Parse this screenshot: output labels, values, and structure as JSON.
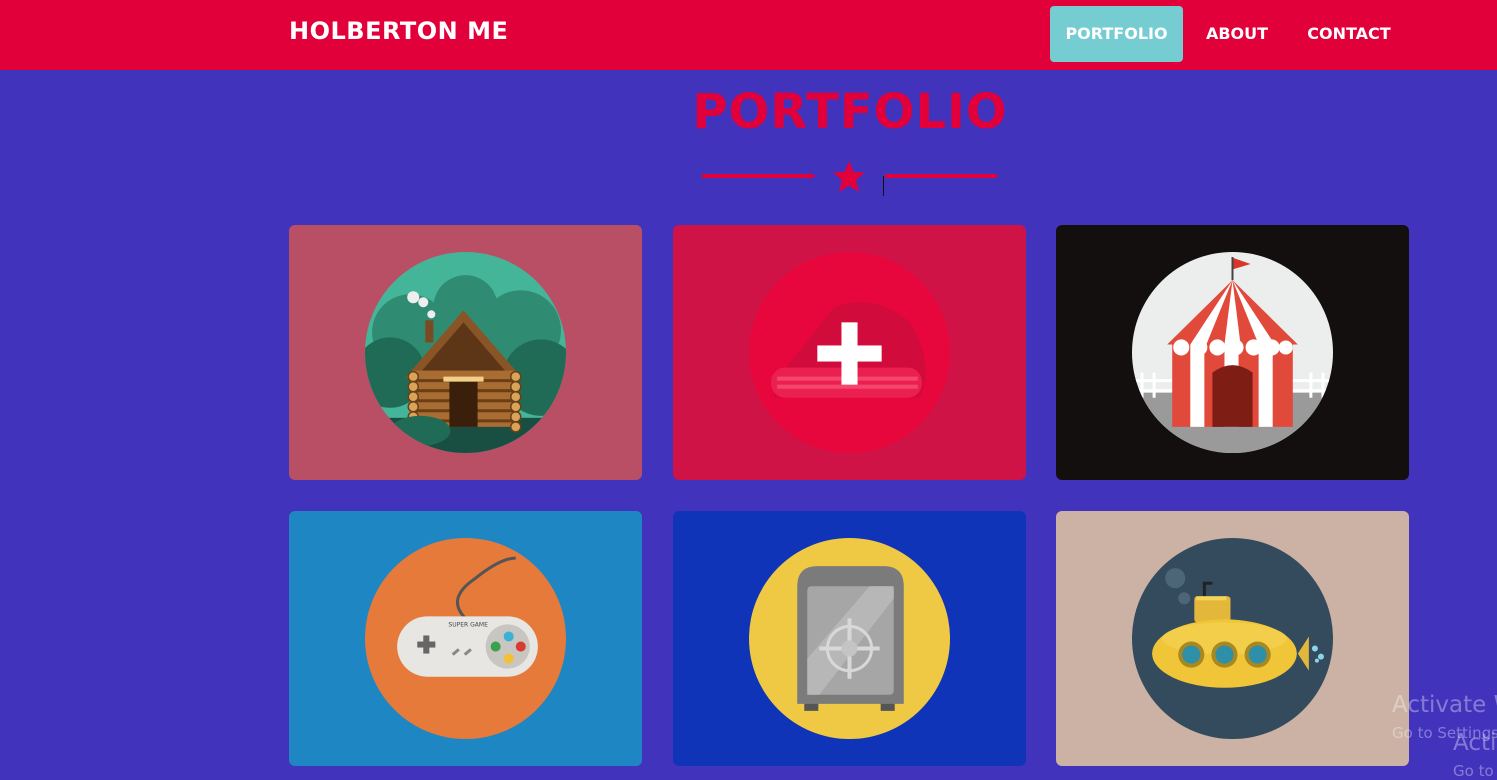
{
  "navbar": {
    "brand": "HOLBERTON ME",
    "links": [
      {
        "label": "PORTFOLIO",
        "active": true
      },
      {
        "label": "ABOUT",
        "active": false
      },
      {
        "label": "CONTACT",
        "active": false
      }
    ],
    "background": "#e2003a",
    "active_color": "#75cdd2"
  },
  "section": {
    "title": "PORTFOLIO",
    "divider_icon": "star-icon",
    "accent": "#e2003a",
    "page_background": "#4233bd"
  },
  "portfolio": {
    "items": [
      {
        "icon": "log-cabin-icon",
        "background": "#b94f65",
        "hovered": false
      },
      {
        "icon": "plus-icon",
        "background": "#cf1346",
        "hovered": true
      },
      {
        "icon": "circus-tent-icon",
        "background": "#140f0f",
        "hovered": false
      },
      {
        "icon": "game-controller-icon",
        "background": "#1f86c4",
        "hovered": false,
        "label": "SUPER GAME"
      },
      {
        "icon": "safe-icon",
        "background": "#1034b7",
        "hovered": false
      },
      {
        "icon": "submarine-icon",
        "background": "#ccb2a4",
        "hovered": false
      }
    ]
  },
  "watermark": {
    "title": "Activate W",
    "subtitle": "Go to Settings",
    "title_2": "Acti",
    "subtitle_2": "Go to"
  }
}
